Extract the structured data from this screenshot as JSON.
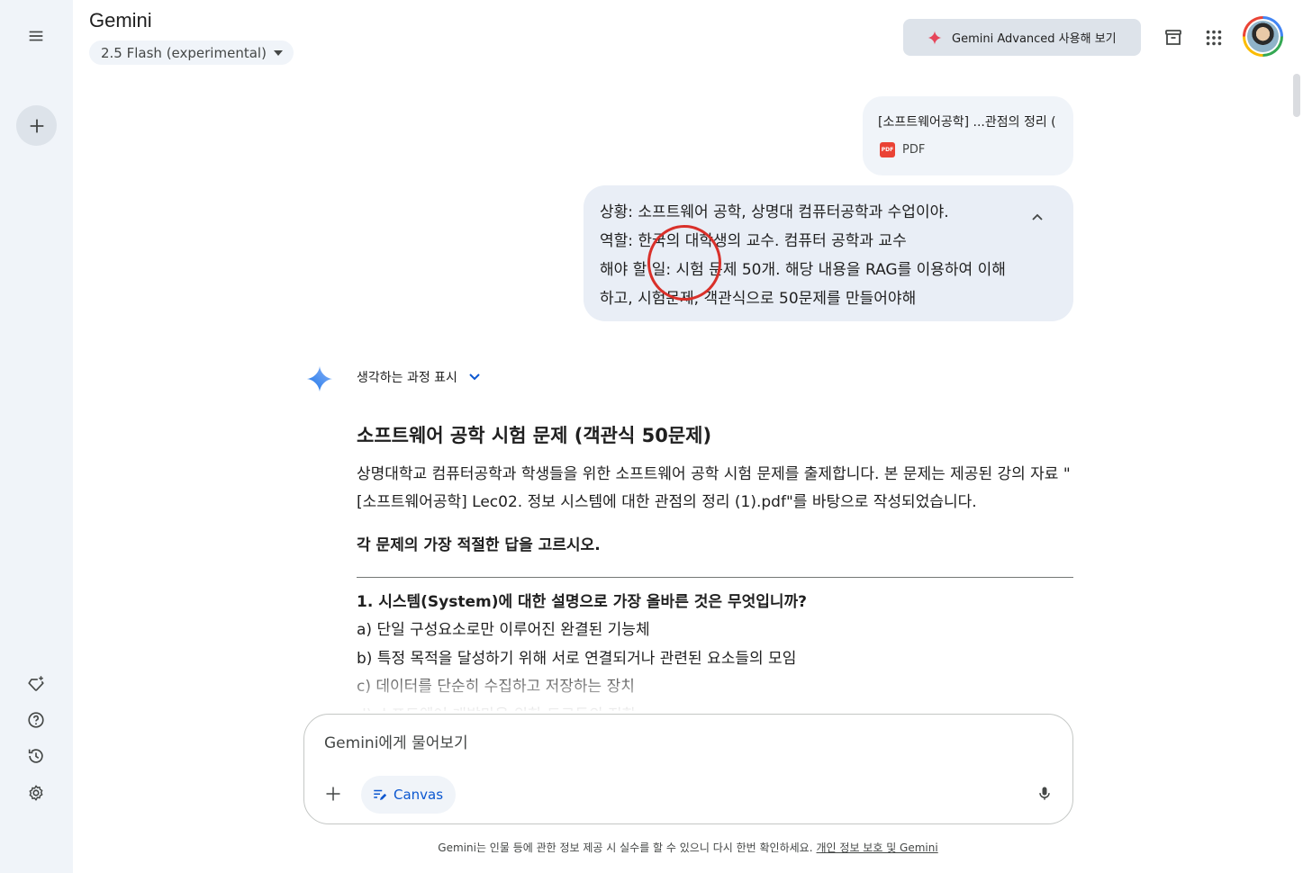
{
  "app": {
    "title": "Gemini",
    "model_label": "2.5 Flash (experimental)",
    "advanced_button": "Gemini Advanced 사용해 보기"
  },
  "attachment": {
    "file_name": "[소프트웨어공학] ...관점의 정리 (",
    "file_type": "PDF",
    "badge": "PDF"
  },
  "user_message": {
    "lines": [
      "상황: 소프트웨어 공학, 상명대 컴퓨터공학과 수업이야.",
      "역할: 한국의 대학생의 교수. 컴퓨터 공학과 교수",
      "해야 할 일: 시험 문제 50개. 해당 내용을 RAG를 이용하여 이해",
      "하고, 시험문제, 객관식으로 50문제를 만들어야해"
    ]
  },
  "response": {
    "thinking_label": "생각하는 과정 표시",
    "title": "소프트웨어 공학 시험 문제 (객관식 50문제)",
    "intro": "상명대학교 컴퓨터공학과 학생들을 위한 소프트웨어 공학 시험 문제를 출제합니다. 본 문제는 제공된 강의 자료 \"[소프트웨어공학] Lec02. 정보 시스템에 대한 관점의 정리 (1).pdf\"를 바탕으로 작성되었습니다.",
    "instruction": "각 문제의 가장 적절한 답을 고르시오.",
    "question_1": {
      "title": "1. 시스템(System)에 대한 설명으로 가장 올바른 것은 무엇입니까?",
      "options": [
        "a) 단일 구성요소로만 이루어진 완결된 기능체",
        "b) 특정 목적을 달성하기 위해 서로 연결되거나 관련된 요소들의 모임",
        "c) 데이터를 단순히 수집하고 저장하는 장치",
        "d) 소프트웨어 개발만을 위한 도구들의 집합"
      ]
    }
  },
  "composer": {
    "placeholder": "Gemini에게 물어보기",
    "canvas_label": "Canvas"
  },
  "footer": {
    "disclaimer": "Gemini는 인물 등에 관한 정보 제공 시 실수를 할 수 있으니 다시 한번 확인하세요.",
    "privacy_link": "개인 정보 보호 및 Gemini"
  },
  "icons": {
    "menu": "menu-icon",
    "new_chat": "plus-icon",
    "gems": "gem-sparkle-icon",
    "help": "help-icon",
    "activity": "history-icon",
    "settings": "settings-icon",
    "archive": "archive-icon",
    "apps": "apps-grid-icon",
    "gemini": "gemini-sparkle-icon",
    "mic": "mic-icon"
  },
  "colors": {
    "rail_bg": "#f0f4f9",
    "bubble_bg": "#e9eef6",
    "accent_blue": "#0b57d0",
    "annotation_red": "#d9302a"
  }
}
